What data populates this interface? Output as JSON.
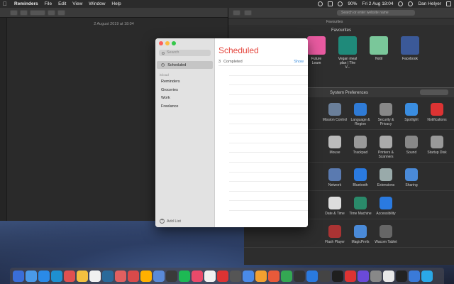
{
  "menubar": {
    "app_name": "Reminders",
    "menus": [
      "File",
      "Edit",
      "View",
      "Window",
      "Help"
    ],
    "battery": "90%",
    "datetime": "Fri 2 Aug 18:04",
    "user": "Dan Helyer"
  },
  "notes_window": {
    "date": "2 August 2019 at 18:04"
  },
  "safari": {
    "url_placeholder": "Search or enter website name",
    "tab_label": "Favourites",
    "favourites_title": "Favourites",
    "favourites": [
      {
        "label": "Future Learn",
        "color": "#e85aa0"
      },
      {
        "label": "Vegan meal plan | The V...",
        "color": "#1f8a7a"
      },
      {
        "label": "Notil",
        "color": "#7ac79a"
      },
      {
        "label": "Facebook",
        "color": "#3b5998"
      }
    ]
  },
  "system_preferences": {
    "title": "System Preferences",
    "rows": [
      [
        {
          "label": "Mission Control",
          "color": "#6a7f9a"
        },
        {
          "label": "Language & Region",
          "color": "#2f7bd6"
        },
        {
          "label": "Security & Privacy",
          "color": "#888"
        },
        {
          "label": "Spotlight",
          "color": "#3a8de0"
        },
        {
          "label": "Notifications",
          "color": "#d33"
        }
      ],
      [
        {
          "label": "Mouse",
          "color": "#bbb"
        },
        {
          "label": "Trackpad",
          "color": "#999"
        },
        {
          "label": "Printers & Scanners",
          "color": "#aaa"
        },
        {
          "label": "Sound",
          "color": "#888"
        },
        {
          "label": "Startup Disk",
          "color": "#999"
        }
      ],
      [
        {
          "label": "Network",
          "color": "#5a7ab0"
        },
        {
          "label": "Bluetooth",
          "color": "#2a7ae0"
        },
        {
          "label": "Extensions",
          "color": "#9aa"
        },
        {
          "label": "Sharing",
          "color": "#4a8ad8"
        }
      ],
      [
        {
          "label": "Date & Time",
          "color": "#ddd"
        },
        {
          "label": "Time Machine",
          "color": "#2a8a6a"
        },
        {
          "label": "Accessibility",
          "color": "#2a7ae0"
        }
      ],
      [
        {
          "label": "Flash Player",
          "color": "#a33"
        },
        {
          "label": "MagicPrefs",
          "color": "#4a8ad8"
        },
        {
          "label": "Wacom Tablet",
          "color": "#666"
        }
      ]
    ]
  },
  "reminders": {
    "search_placeholder": "Search",
    "smart_list": "Scheduled",
    "section": "iCloud",
    "lists": [
      "Reminders",
      "Groceries",
      "Work",
      "Freelance"
    ],
    "add_list": "Add List",
    "heading": "Scheduled",
    "completed_count": "3",
    "completed_label": "Completed",
    "show_label": "Show"
  },
  "dock": {
    "icons": [
      "#3a6ed8",
      "#4a9ae8",
      "#2a8ae8",
      "#1e90d0",
      "#e05050",
      "#f2c040",
      "#f0f0f0",
      "#2a6a9a",
      "#e06060",
      "#d94a4a",
      "#ffb000",
      "#5a8ad8",
      "#3a3a3a",
      "#1db954",
      "#ea4a6a",
      "#f0f0f0",
      "#d33",
      "#555",
      "#4a8ae8",
      "#f2a030",
      "#e85a3a",
      "#34a853",
      "#333",
      "#2a7ae0",
      "#444",
      "#1f1f1f",
      "#d33",
      "#6a4ad8",
      "#888",
      "#e8e8e8",
      "#222",
      "#3a7ad8",
      "#2aa8e8"
    ]
  }
}
